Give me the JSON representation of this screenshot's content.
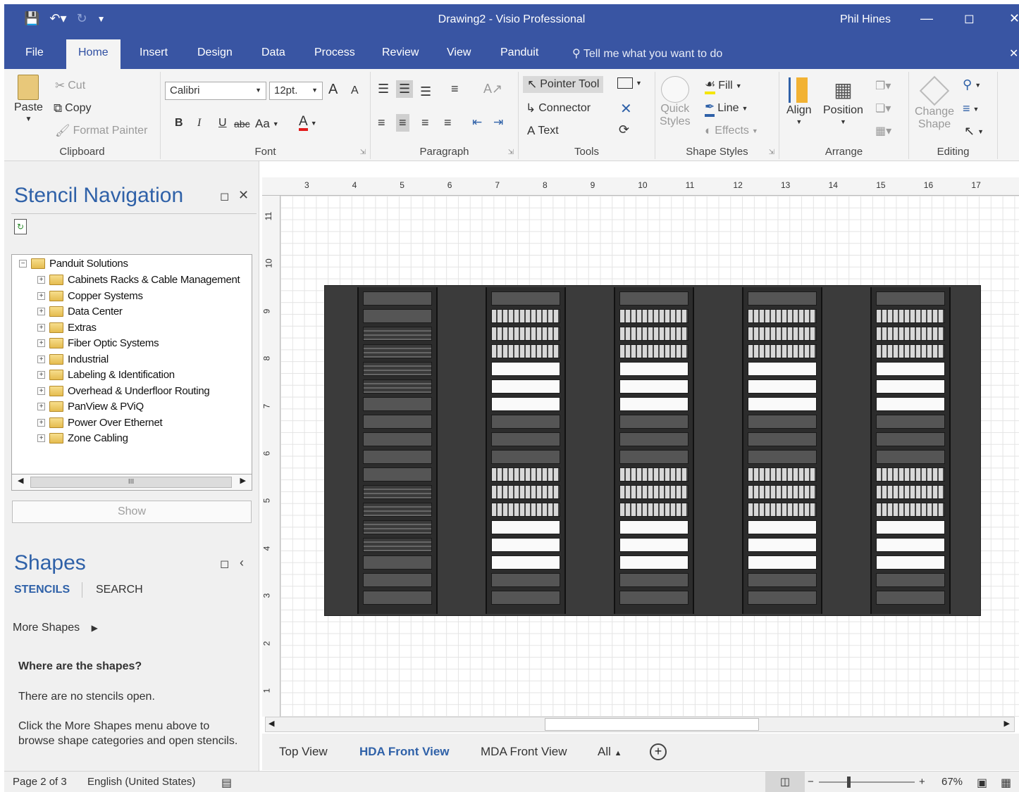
{
  "titlebar": {
    "title": "Drawing2 - Visio Professional",
    "user": "Phil Hines",
    "qat_icons": [
      "save-icon",
      "undo-icon",
      "redo-icon",
      "customize-qat-icon"
    ]
  },
  "tabs": [
    "File",
    "Home",
    "Insert",
    "Design",
    "Data",
    "Process",
    "Review",
    "View",
    "Panduit"
  ],
  "active_tab": "Home",
  "tell_me": "Tell me what you want to do",
  "ribbon": {
    "clipboard": {
      "paste": "Paste",
      "cut": "Cut",
      "copy": "Copy",
      "format_painter": "Format Painter",
      "label": "Clipboard"
    },
    "font": {
      "name": "Calibri",
      "size": "12pt.",
      "bold": "B",
      "italic": "I",
      "underline": "U",
      "strike": "abc",
      "case": "Aa",
      "color": "A",
      "grow": "A",
      "shrink": "A",
      "label": "Font"
    },
    "paragraph": {
      "label": "Paragraph"
    },
    "tools": {
      "pointer": "Pointer Tool",
      "connector": "Connector",
      "text": "Text",
      "label": "Tools"
    },
    "shape_styles": {
      "quick_1": "Quick",
      "quick_2": "Styles",
      "fill": "Fill",
      "line": "Line",
      "effects": "Effects",
      "label": "Shape Styles"
    },
    "arrange": {
      "align": "Align",
      "position": "Position",
      "label": "Arrange"
    },
    "editing": {
      "change_1": "Change",
      "change_2": "Shape",
      "label": "Editing"
    }
  },
  "stencil_nav": {
    "title": "Stencil Navigation",
    "tree_root": "Panduit Solutions",
    "tree_items": [
      "Cabinets Racks & Cable Management",
      "Copper Systems",
      "Data Center",
      "Extras",
      "Fiber Optic Systems",
      "Industrial",
      "Labeling & Identification",
      "Overhead & Underfloor Routing",
      "PanView & PViQ",
      "Power Over Ethernet",
      "Zone Cabling"
    ],
    "scroll_thumb": "III",
    "show_button": "Show"
  },
  "shapes": {
    "title": "Shapes",
    "stencils_tab": "STENCILS",
    "search_tab": "SEARCH",
    "more_shapes": "More Shapes",
    "where_heading": "Where are the shapes?",
    "no_stencils": "There are no stencils open.",
    "hint_1": "Click the More Shapes menu above to",
    "hint_2": "browse shape categories and open stencils."
  },
  "ruler": {
    "top": [
      "3",
      "4",
      "5",
      "6",
      "7",
      "8",
      "9",
      "10",
      "11",
      "12",
      "13",
      "14",
      "15",
      "16",
      "17"
    ],
    "left": [
      "11",
      "10",
      "9",
      "8",
      "7",
      "6",
      "5",
      "4",
      "3",
      "2",
      "1"
    ]
  },
  "page_tabs": [
    "Top View",
    "HDA Front View",
    "MDA Front View",
    "All"
  ],
  "active_page": "HDA Front View",
  "status": {
    "page": "Page 2 of 3",
    "language": "English (United States)",
    "zoom": "67%"
  }
}
